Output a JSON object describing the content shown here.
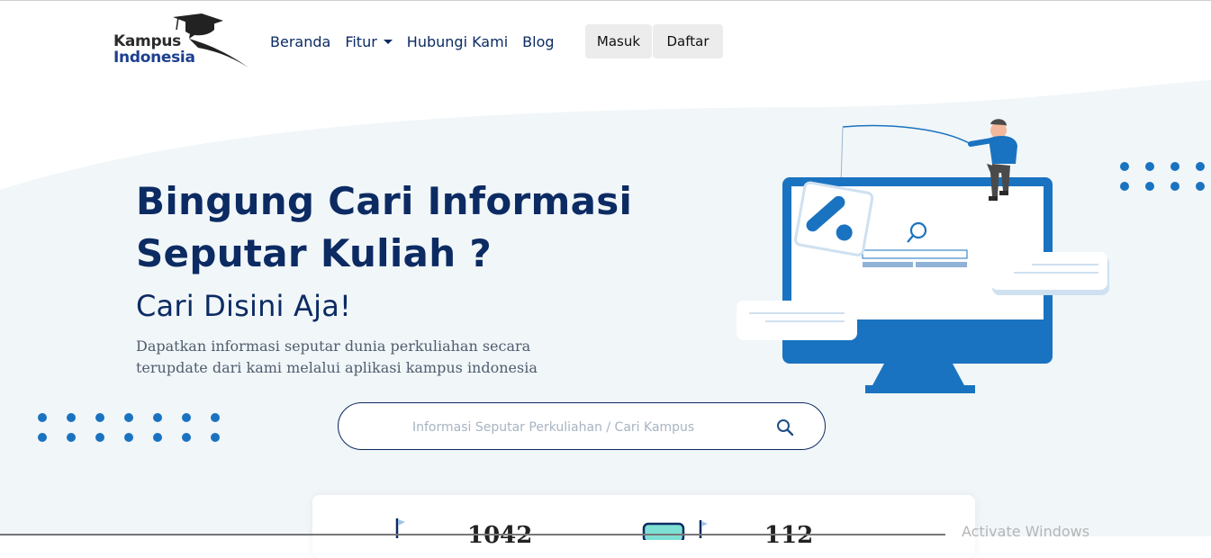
{
  "brand": {
    "line1": "Kampus",
    "line2": "Indonesia"
  },
  "nav": {
    "items": [
      {
        "label": "Beranda"
      },
      {
        "label": "Fitur",
        "dropdown": true
      },
      {
        "label": "Hubungi Kami"
      },
      {
        "label": "Blog"
      }
    ],
    "login_label": "Masuk",
    "register_label": "Daftar"
  },
  "hero": {
    "title_line1": "Bingung Cari Informasi",
    "title_line2": "Seputar Kuliah ?",
    "subtitle": "Cari Disini Aja!",
    "description_line1": "Dapatkan informasi seputar dunia perkuliahan secara",
    "description_line2": "terupdate dari kami melalui aplikasi kampus indonesia"
  },
  "search": {
    "placeholder": "Informasi Seputar Perkuliahan / Cari Kampus",
    "value": ""
  },
  "stats": {
    "stat1_value": "1042",
    "stat2_value": "112"
  },
  "system": {
    "watermark": "Activate Windows"
  },
  "colors": {
    "navy": "#0c2b63",
    "brand_blue": "#1a73c0",
    "hero_bg": "#f1f6f9"
  },
  "icons": [
    "graduation-cap-icon",
    "caret-down-icon",
    "search-icon",
    "flag-icon"
  ]
}
